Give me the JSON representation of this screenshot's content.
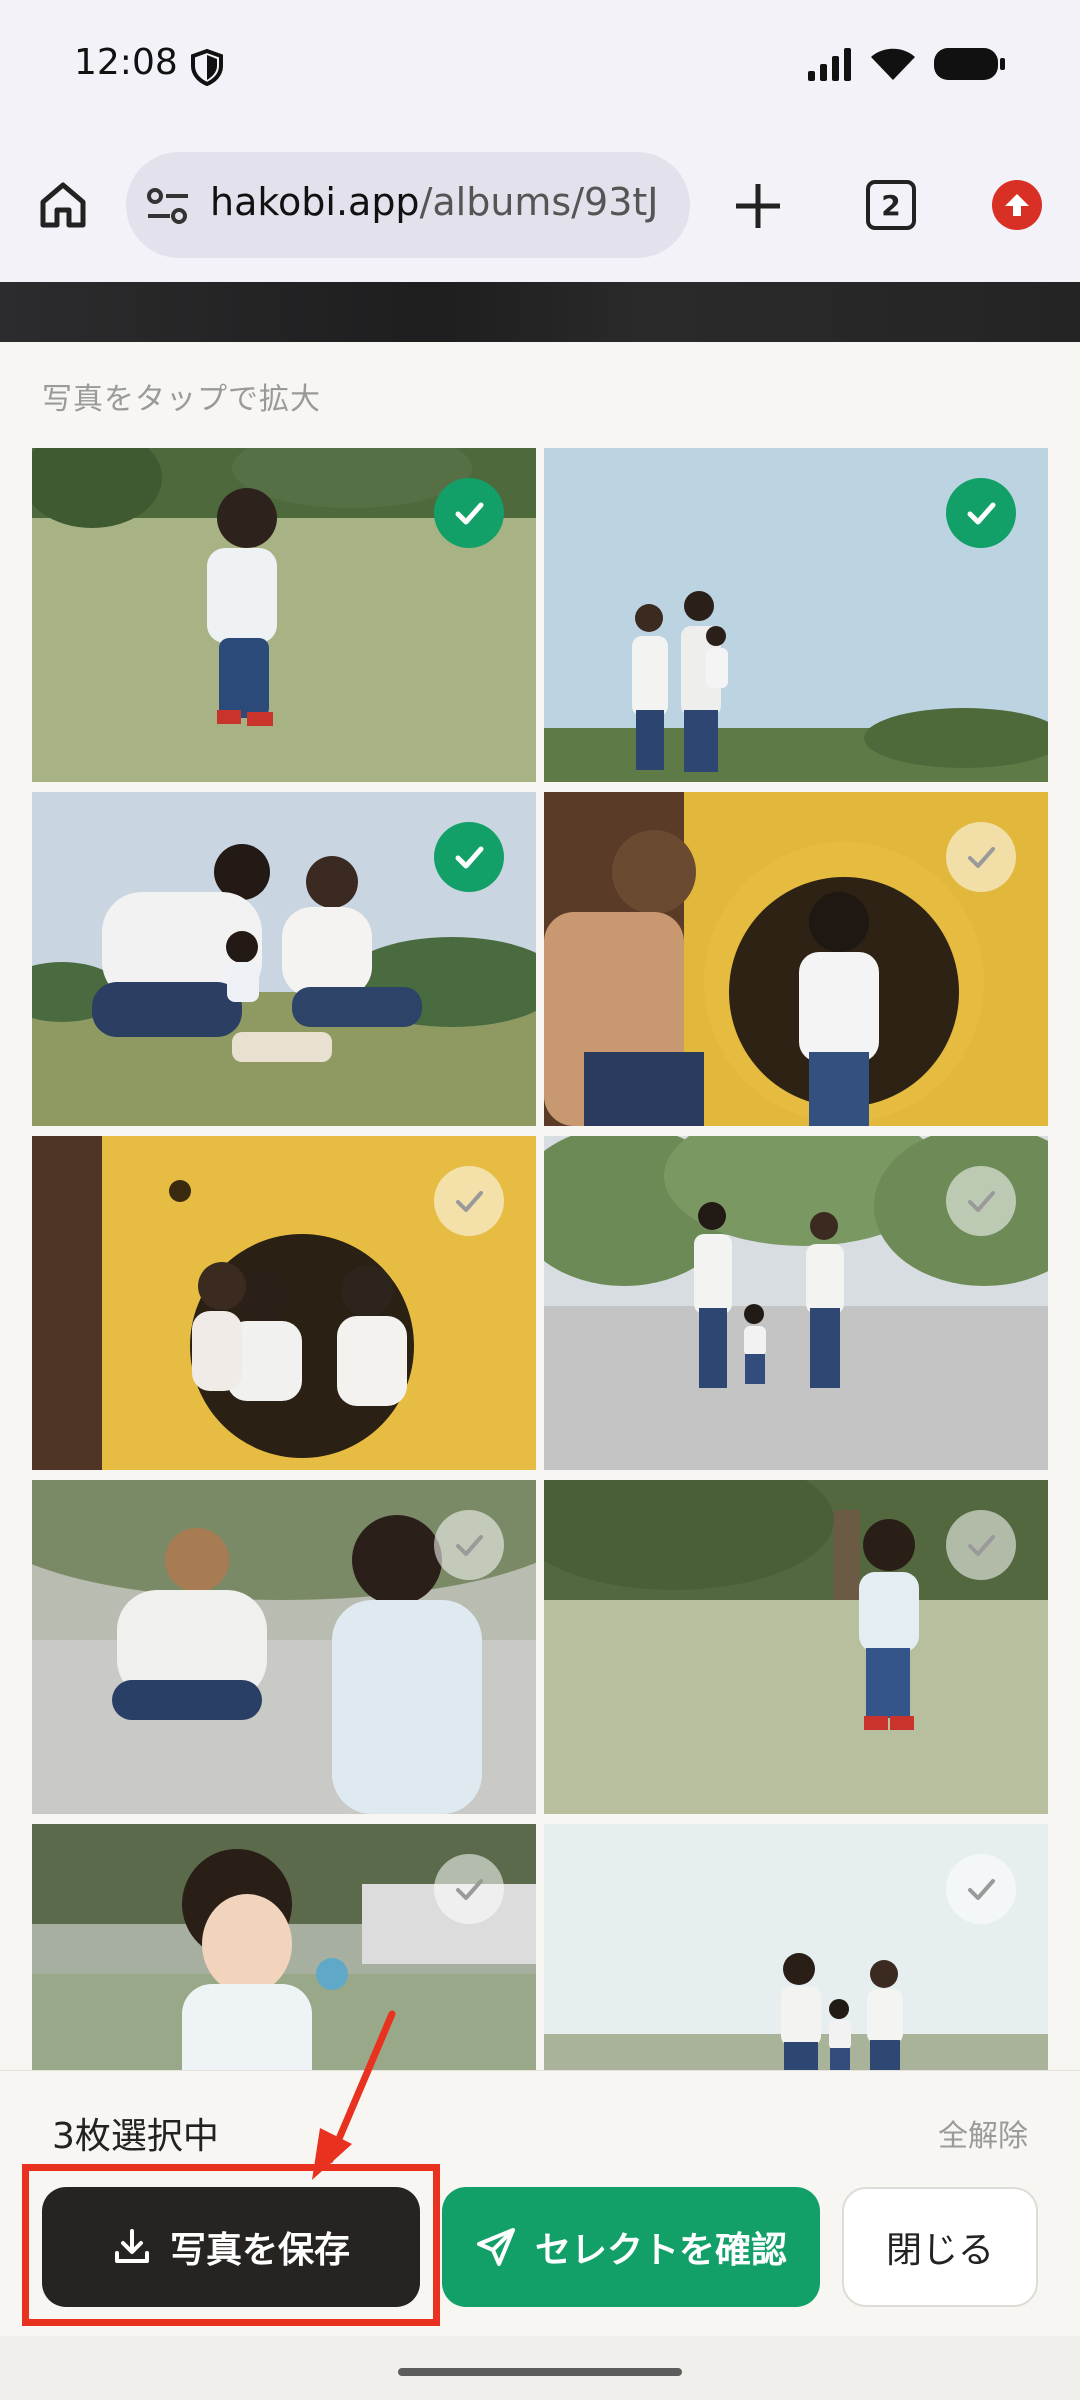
{
  "status_bar": {
    "time": "12:08"
  },
  "browser": {
    "url_domain": "hakobi.app",
    "url_path": "/albums/93tJ",
    "tab_count": "2"
  },
  "hint": "写真をタップで拡大",
  "photos": [
    {
      "selected": true
    },
    {
      "selected": true
    },
    {
      "selected": true
    },
    {
      "selected": false
    },
    {
      "selected": false
    },
    {
      "selected": false
    },
    {
      "selected": false
    },
    {
      "selected": false
    },
    {
      "selected": false
    },
    {
      "selected": false
    }
  ],
  "bottom": {
    "selection_count": "3枚選択中",
    "clear_all": "全解除",
    "save_label": "写真を保存",
    "confirm_label": "セレクトを確認",
    "close_label": "閉じる"
  },
  "colors": {
    "accent_green": "#12a068",
    "save_dark": "#272321",
    "highlight_red": "#e8321f"
  }
}
